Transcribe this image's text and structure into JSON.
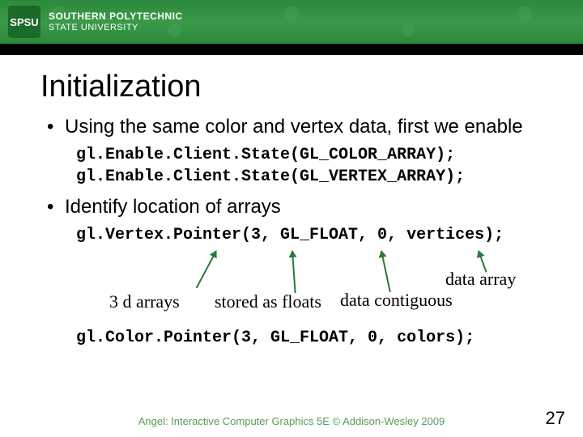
{
  "header": {
    "logo_abbrev": "SPSU",
    "logo_line1": "SOUTHERN POLYTECHNIC",
    "logo_line2": "STATE UNIVERSITY"
  },
  "slide": {
    "title": "Initialization",
    "bullet1": "Using the same color and vertex data, first we enable",
    "code1a": "gl.Enable.Client.State(GL_COLOR_ARRAY);",
    "code1b": "gl.Enable.Client.State(GL_VERTEX_ARRAY);",
    "bullet2": "Identify location of arrays",
    "code2": "gl.Vertex.Pointer(3, GL_FLOAT, 0, vertices);",
    "annotations": {
      "a1": "3 d arrays",
      "a2": "stored as floats",
      "a3": "data contiguous",
      "a4": "data array"
    },
    "code3": "gl.Color.Pointer(3, GL_FLOAT, 0, colors);"
  },
  "footer": {
    "credit": "Angel: Interactive Computer Graphics 5E © Addison-Wesley 2009",
    "page": "27"
  }
}
